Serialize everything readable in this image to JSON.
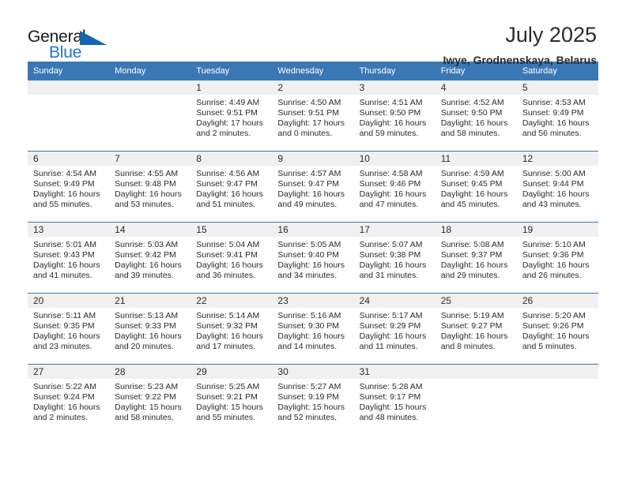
{
  "brand": {
    "name_part1": "General",
    "name_part2": "Blue",
    "logo_icon": "triangle-icon",
    "color_primary": "#2376c4",
    "color_triangle": "#1366ad"
  },
  "header": {
    "title": "July 2025",
    "subtitle": "Iwye, Grodnenskaya, Belarus"
  },
  "theme": {
    "header_blue": "#3a78b5",
    "daynum_gray": "#f0f0f0",
    "text": "#2b2b2b"
  },
  "weekday_headers": [
    "Sunday",
    "Monday",
    "Tuesday",
    "Wednesday",
    "Thursday",
    "Friday",
    "Saturday"
  ],
  "weeks": [
    {
      "days": [
        {
          "number": "",
          "empty": true,
          "sunrise": "",
          "sunset": "",
          "daylight": ""
        },
        {
          "number": "",
          "empty": true,
          "sunrise": "",
          "sunset": "",
          "daylight": ""
        },
        {
          "number": "1",
          "sunrise": "Sunrise: 4:49 AM",
          "sunset": "Sunset: 9:51 PM",
          "daylight": "Daylight: 17 hours and 2 minutes."
        },
        {
          "number": "2",
          "sunrise": "Sunrise: 4:50 AM",
          "sunset": "Sunset: 9:51 PM",
          "daylight": "Daylight: 17 hours and 0 minutes."
        },
        {
          "number": "3",
          "sunrise": "Sunrise: 4:51 AM",
          "sunset": "Sunset: 9:50 PM",
          "daylight": "Daylight: 16 hours and 59 minutes."
        },
        {
          "number": "4",
          "sunrise": "Sunrise: 4:52 AM",
          "sunset": "Sunset: 9:50 PM",
          "daylight": "Daylight: 16 hours and 58 minutes."
        },
        {
          "number": "5",
          "sunrise": "Sunrise: 4:53 AM",
          "sunset": "Sunset: 9:49 PM",
          "daylight": "Daylight: 16 hours and 56 minutes."
        }
      ]
    },
    {
      "days": [
        {
          "number": "6",
          "sunrise": "Sunrise: 4:54 AM",
          "sunset": "Sunset: 9:49 PM",
          "daylight": "Daylight: 16 hours and 55 minutes."
        },
        {
          "number": "7",
          "sunrise": "Sunrise: 4:55 AM",
          "sunset": "Sunset: 9:48 PM",
          "daylight": "Daylight: 16 hours and 53 minutes."
        },
        {
          "number": "8",
          "sunrise": "Sunrise: 4:56 AM",
          "sunset": "Sunset: 9:47 PM",
          "daylight": "Daylight: 16 hours and 51 minutes."
        },
        {
          "number": "9",
          "sunrise": "Sunrise: 4:57 AM",
          "sunset": "Sunset: 9:47 PM",
          "daylight": "Daylight: 16 hours and 49 minutes."
        },
        {
          "number": "10",
          "sunrise": "Sunrise: 4:58 AM",
          "sunset": "Sunset: 9:46 PM",
          "daylight": "Daylight: 16 hours and 47 minutes."
        },
        {
          "number": "11",
          "sunrise": "Sunrise: 4:59 AM",
          "sunset": "Sunset: 9:45 PM",
          "daylight": "Daylight: 16 hours and 45 minutes."
        },
        {
          "number": "12",
          "sunrise": "Sunrise: 5:00 AM",
          "sunset": "Sunset: 9:44 PM",
          "daylight": "Daylight: 16 hours and 43 minutes."
        }
      ]
    },
    {
      "days": [
        {
          "number": "13",
          "sunrise": "Sunrise: 5:01 AM",
          "sunset": "Sunset: 9:43 PM",
          "daylight": "Daylight: 16 hours and 41 minutes."
        },
        {
          "number": "14",
          "sunrise": "Sunrise: 5:03 AM",
          "sunset": "Sunset: 9:42 PM",
          "daylight": "Daylight: 16 hours and 39 minutes."
        },
        {
          "number": "15",
          "sunrise": "Sunrise: 5:04 AM",
          "sunset": "Sunset: 9:41 PM",
          "daylight": "Daylight: 16 hours and 36 minutes."
        },
        {
          "number": "16",
          "sunrise": "Sunrise: 5:05 AM",
          "sunset": "Sunset: 9:40 PM",
          "daylight": "Daylight: 16 hours and 34 minutes."
        },
        {
          "number": "17",
          "sunrise": "Sunrise: 5:07 AM",
          "sunset": "Sunset: 9:38 PM",
          "daylight": "Daylight: 16 hours and 31 minutes."
        },
        {
          "number": "18",
          "sunrise": "Sunrise: 5:08 AM",
          "sunset": "Sunset: 9:37 PM",
          "daylight": "Daylight: 16 hours and 29 minutes."
        },
        {
          "number": "19",
          "sunrise": "Sunrise: 5:10 AM",
          "sunset": "Sunset: 9:36 PM",
          "daylight": "Daylight: 16 hours and 26 minutes."
        }
      ]
    },
    {
      "days": [
        {
          "number": "20",
          "sunrise": "Sunrise: 5:11 AM",
          "sunset": "Sunset: 9:35 PM",
          "daylight": "Daylight: 16 hours and 23 minutes."
        },
        {
          "number": "21",
          "sunrise": "Sunrise: 5:13 AM",
          "sunset": "Sunset: 9:33 PM",
          "daylight": "Daylight: 16 hours and 20 minutes."
        },
        {
          "number": "22",
          "sunrise": "Sunrise: 5:14 AM",
          "sunset": "Sunset: 9:32 PM",
          "daylight": "Daylight: 16 hours and 17 minutes."
        },
        {
          "number": "23",
          "sunrise": "Sunrise: 5:16 AM",
          "sunset": "Sunset: 9:30 PM",
          "daylight": "Daylight: 16 hours and 14 minutes."
        },
        {
          "number": "24",
          "sunrise": "Sunrise: 5:17 AM",
          "sunset": "Sunset: 9:29 PM",
          "daylight": "Daylight: 16 hours and 11 minutes."
        },
        {
          "number": "25",
          "sunrise": "Sunrise: 5:19 AM",
          "sunset": "Sunset: 9:27 PM",
          "daylight": "Daylight: 16 hours and 8 minutes."
        },
        {
          "number": "26",
          "sunrise": "Sunrise: 5:20 AM",
          "sunset": "Sunset: 9:26 PM",
          "daylight": "Daylight: 16 hours and 5 minutes."
        }
      ]
    },
    {
      "days": [
        {
          "number": "27",
          "sunrise": "Sunrise: 5:22 AM",
          "sunset": "Sunset: 9:24 PM",
          "daylight": "Daylight: 16 hours and 2 minutes."
        },
        {
          "number": "28",
          "sunrise": "Sunrise: 5:23 AM",
          "sunset": "Sunset: 9:22 PM",
          "daylight": "Daylight: 15 hours and 58 minutes."
        },
        {
          "number": "29",
          "sunrise": "Sunrise: 5:25 AM",
          "sunset": "Sunset: 9:21 PM",
          "daylight": "Daylight: 15 hours and 55 minutes."
        },
        {
          "number": "30",
          "sunrise": "Sunrise: 5:27 AM",
          "sunset": "Sunset: 9:19 PM",
          "daylight": "Daylight: 15 hours and 52 minutes."
        },
        {
          "number": "31",
          "sunrise": "Sunrise: 5:28 AM",
          "sunset": "Sunset: 9:17 PM",
          "daylight": "Daylight: 15 hours and 48 minutes."
        },
        {
          "number": "",
          "empty": true,
          "sunrise": "",
          "sunset": "",
          "daylight": ""
        },
        {
          "number": "",
          "empty": true,
          "sunrise": "",
          "sunset": "",
          "daylight": ""
        }
      ]
    }
  ]
}
